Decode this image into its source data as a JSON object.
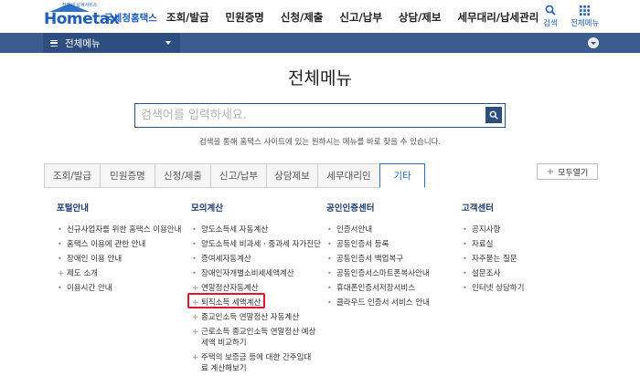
{
  "header": {
    "logo_text": "Hometax",
    "logo_tagline": "전자세 납세서비스",
    "logo_sub": "국세청홈택스",
    "nav": [
      "조회/발급",
      "민원증명",
      "신청/제출",
      "신고/납부",
      "상담/제보",
      "세무대리/납세관리"
    ],
    "search_label": "검색",
    "allmenu_label": "전체메뉴"
  },
  "navband": {
    "current": "전체메뉴"
  },
  "page": {
    "title": "전체메뉴",
    "search_placeholder": "검색어를 입력하세요.",
    "search_hint": "검색을 통해 홈택스 사이트에 있는 원하시는 메뉴를 바로 찾을 수 있습니다."
  },
  "tabs": [
    {
      "label": "조회/발급",
      "active": false
    },
    {
      "label": "민원증명",
      "active": false
    },
    {
      "label": "신청/제출",
      "active": false
    },
    {
      "label": "신고/납부",
      "active": false
    },
    {
      "label": "상담제보",
      "active": false
    },
    {
      "label": "세무대리인",
      "active": false
    },
    {
      "label": "기타",
      "active": true
    }
  ],
  "open_all": "모두열기",
  "columns": [
    {
      "heading": "포털안내",
      "items": [
        {
          "label": "신규사업자를 위한 홈택스 이용안내",
          "marker": "dot"
        },
        {
          "label": "홈택스 이용에 관한 안내",
          "marker": "dot"
        },
        {
          "label": "장애인 이용 안내",
          "marker": "dot"
        },
        {
          "label": "제도 소개",
          "marker": "plus"
        },
        {
          "label": "이용시간 안내",
          "marker": "dot"
        }
      ]
    },
    {
      "heading": "모의계산",
      "items": [
        {
          "label": "양도소득세 자동계산",
          "marker": "dot"
        },
        {
          "label": "양도소득세 비과세 · 중과세 자가진단",
          "marker": "dot"
        },
        {
          "label": "증여세자동계산",
          "marker": "dot"
        },
        {
          "label": "장애인자개별소비세세액계산",
          "marker": "dot"
        },
        {
          "label": "연말정산자동계산",
          "marker": "plus"
        },
        {
          "label": "퇴직소득 세액계산",
          "marker": "plus"
        },
        {
          "label": "종교인소득 연말정산 자동계산",
          "marker": "plus"
        },
        {
          "label": "근로소득 종교인소득 연말정산 예상세액 비교하기",
          "marker": "plus"
        },
        {
          "label": "주택의 보증금 등에 대한 간주임대료 계산해보기",
          "marker": "plus"
        }
      ]
    },
    {
      "heading": "공인인증센터",
      "items": [
        {
          "label": "인증서안내",
          "marker": "dot"
        },
        {
          "label": "공동인증서 등록",
          "marker": "dot"
        },
        {
          "label": "공동인증서 백업복구",
          "marker": "dot"
        },
        {
          "label": "공동인증서스마트폰복사안내",
          "marker": "dot"
        },
        {
          "label": "휴대폰인증서저장서비스",
          "marker": "dot"
        },
        {
          "label": "클라우드 인증서 서비스 안내",
          "marker": "dot"
        }
      ]
    },
    {
      "heading": "고객센터",
      "items": [
        {
          "label": "공지사항",
          "marker": "dot"
        },
        {
          "label": "자료실",
          "marker": "dot"
        },
        {
          "label": "자주묻는 질문",
          "marker": "dot"
        },
        {
          "label": "설문조사",
          "marker": "dot"
        },
        {
          "label": "인터넷 상담하기",
          "marker": "dot"
        }
      ]
    }
  ],
  "colors": {
    "brand_blue": "#1f5fb8",
    "nav_band": "#3b5c8d",
    "active_tab": "#2e6bc4",
    "highlight_red": "#e5142b"
  }
}
